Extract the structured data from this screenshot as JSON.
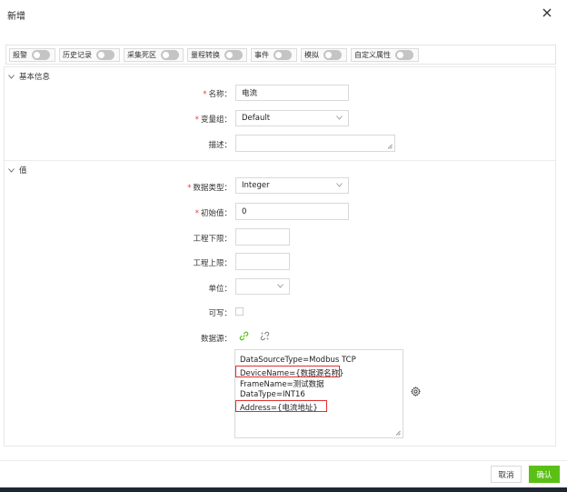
{
  "dialog": {
    "title": "新增"
  },
  "tabs": [
    {
      "label": "报警"
    },
    {
      "label": "历史记录"
    },
    {
      "label": "采集死区"
    },
    {
      "label": "量程转换"
    },
    {
      "label": "事件"
    },
    {
      "label": "模拟"
    },
    {
      "label": "自定义属性"
    }
  ],
  "basic": {
    "header": "基本信息",
    "required_mark": "*",
    "name_label": "名称：",
    "name_value": "电流",
    "group_label": "变量组：",
    "group_value": "Default",
    "desc_label": "描述：",
    "desc_value": ""
  },
  "value": {
    "header": "值",
    "required_mark": "*",
    "datatype_label": "数据类型：",
    "datatype_value": "Integer",
    "initial_label": "初始值：",
    "initial_value": "0",
    "eng_low_label": "工程下限：",
    "eng_low_value": "",
    "eng_high_label": "工程上限：",
    "eng_high_value": "",
    "unit_label": "单位：",
    "unit_value": "",
    "writable_label": "可写：",
    "datasource_label": "数据源：",
    "datasource_lines": [
      "DataSourceType=Modbus TCP",
      "DeviceName={数据源名称}",
      "FrameName=测试数据",
      "DataType=INT16",
      "Address={电流地址}"
    ]
  },
  "footer": {
    "cancel_label": "取消",
    "ok_label": "确认"
  },
  "colors": {
    "primary": "#5bc016",
    "required": "#e53b3b",
    "highlight_box": "#e02f2f",
    "link_icon": "#5bc016"
  }
}
